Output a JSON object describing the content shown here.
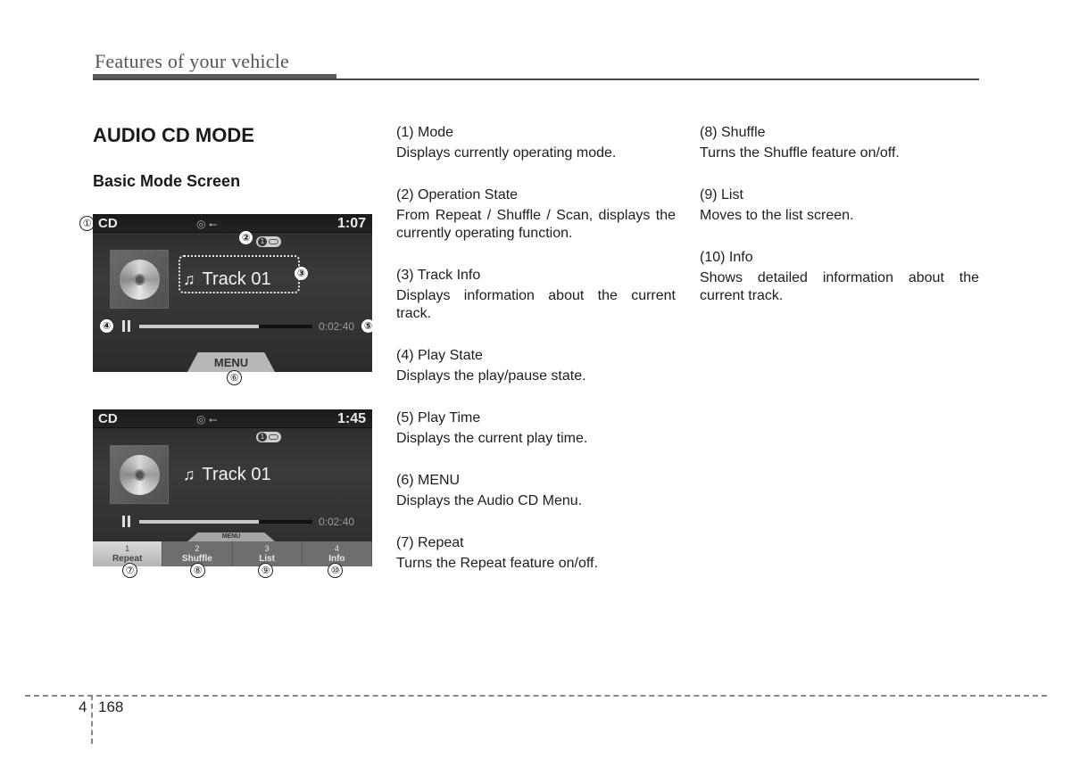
{
  "header": {
    "title": "Features of your vehicle"
  },
  "section_title": "AUDIO CD MODE",
  "subsection_title": "Basic Mode Screen",
  "screens": [
    {
      "mode": "CD",
      "source_icons": "◎ ⭠",
      "clock": "1:07",
      "op_state_label": "1",
      "track": "Track 01",
      "play_time": "0:02:40",
      "progress_fraction": 0.69,
      "menu_label": "MENU"
    },
    {
      "mode": "CD",
      "source_icons": "◎ ⭠",
      "clock": "1:45",
      "op_state_label": "1",
      "track": "Track 01",
      "play_time": "0:02:40",
      "progress_fraction": 0.69,
      "menu_label": "MENU",
      "softkeys": [
        {
          "num": "1",
          "label": "Repeat"
        },
        {
          "num": "2",
          "label": "Shuffle"
        },
        {
          "num": "3",
          "label": "List"
        },
        {
          "num": "4",
          "label": "Info"
        }
      ]
    }
  ],
  "callouts": [
    "①",
    "②",
    "③",
    "④",
    "⑤",
    "⑥",
    "⑦",
    "⑧",
    "⑨",
    "⑩"
  ],
  "descriptions": [
    {
      "term": "(1) Mode",
      "desc": "Displays currently operating mode."
    },
    {
      "term": "(2) Operation State",
      "desc": "From Repeat / Shuffle / Scan, displays the currently operating function."
    },
    {
      "term": "(3) Track Info",
      "desc": "Displays information about the current track."
    },
    {
      "term": "(4) Play State",
      "desc": "Displays the play/pause state."
    },
    {
      "term": "(5) Play Time",
      "desc": "Displays the current play time."
    },
    {
      "term": "(6) MENU",
      "desc": "Displays the Audio CD Menu."
    },
    {
      "term": "(7) Repeat",
      "desc": "Turns the Repeat feature on/off."
    },
    {
      "term": "(8) Shuffle",
      "desc": "Turns the Shuffle feature on/off."
    },
    {
      "term": "(9) List",
      "desc": "Moves to the list screen."
    },
    {
      "term": "(10) Info",
      "desc": "Shows detailed information about the current track."
    }
  ],
  "footer": {
    "chapter": "4",
    "page": "168"
  }
}
